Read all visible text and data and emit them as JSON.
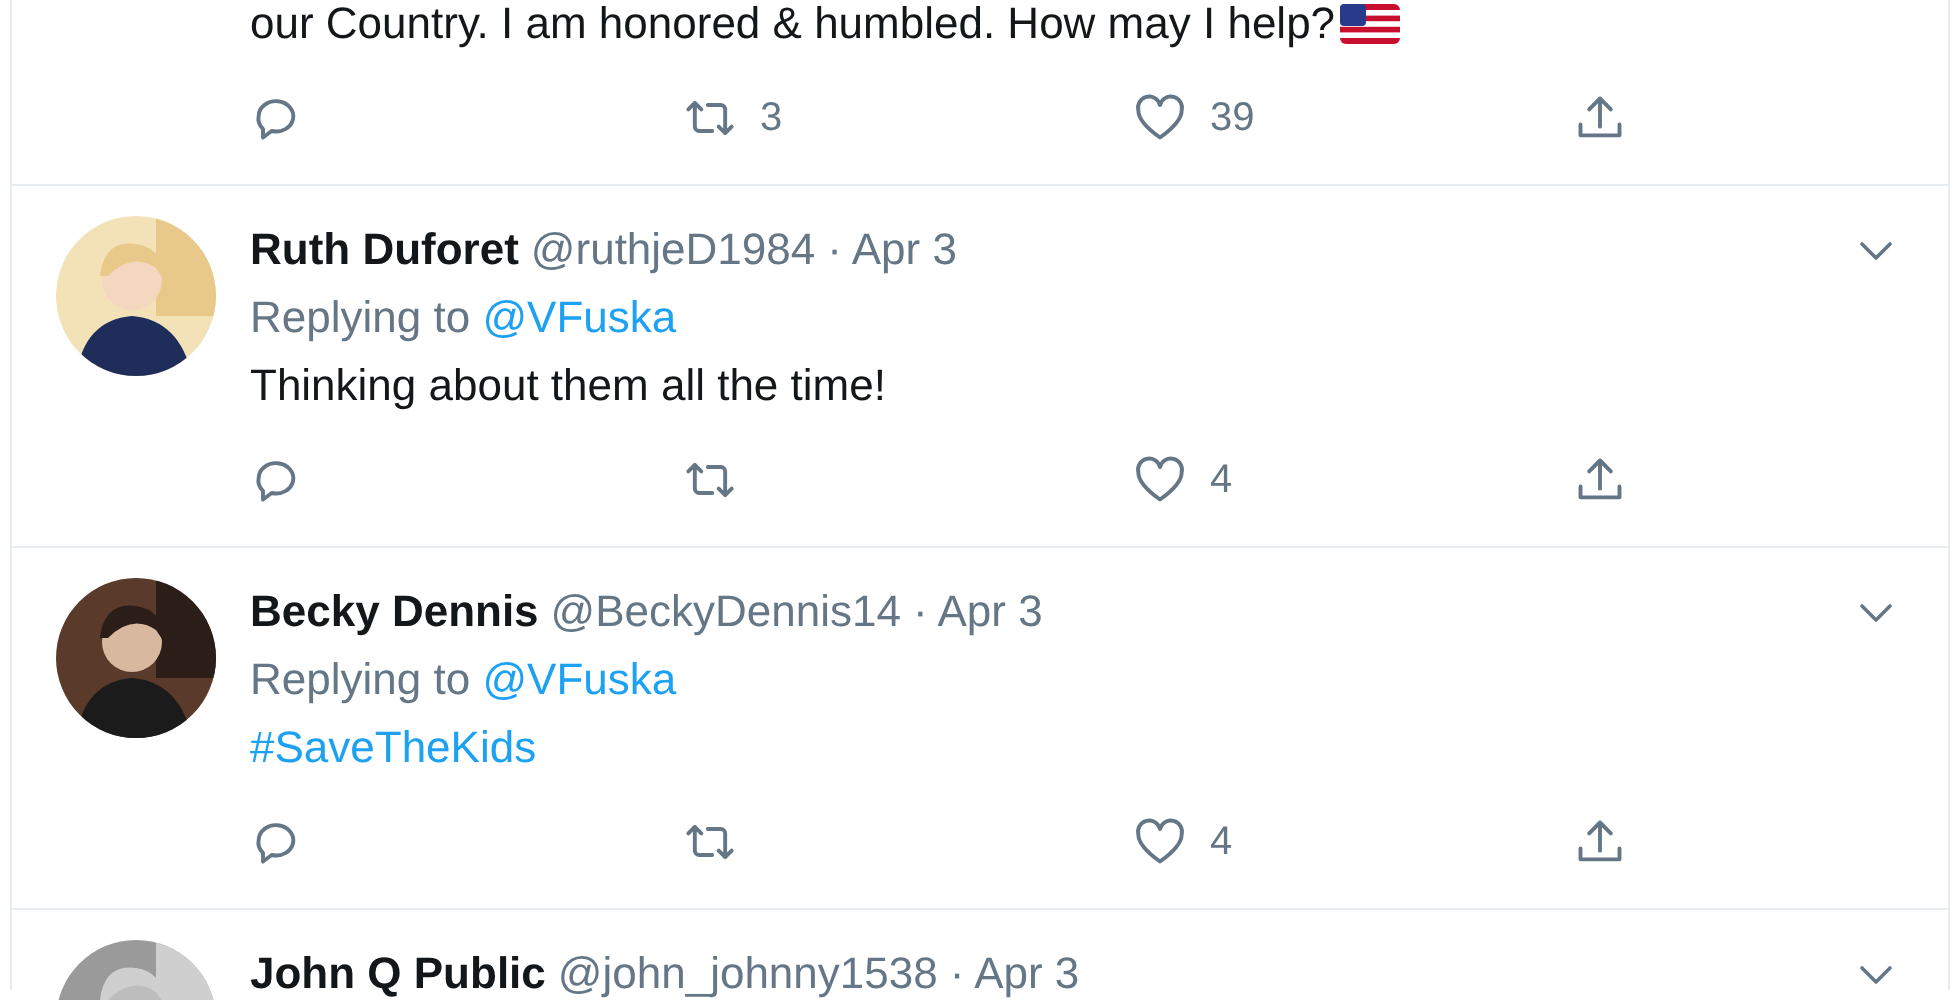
{
  "tweets": [
    {
      "kind": "partial",
      "body": {
        "kind": "text",
        "text": "our Country. I am honored & humbled. How may I help?"
      },
      "actions": {
        "retweets": "3",
        "likes": "39"
      }
    },
    {
      "kind": "reply",
      "name": "Ruth Duforet",
      "handle": "@ruthjeD1984",
      "date": "· Apr 3",
      "replying": "Replying to",
      "reply_to": "@VFuska",
      "body": {
        "kind": "text",
        "text": "Thinking about them all the time!"
      },
      "actions": {
        "likes": "4"
      }
    },
    {
      "kind": "reply",
      "name": "Becky Dennis",
      "handle": "@BeckyDennis14",
      "date": "· Apr 3",
      "replying": "Replying to",
      "reply_to": "@VFuska",
      "body": {
        "kind": "hashtag",
        "text": "#SaveTheKids"
      },
      "actions": {
        "likes": "4"
      }
    },
    {
      "kind": "header",
      "name": "John Q Public",
      "handle": "@john_johnny1538",
      "date": "· Apr 3"
    }
  ]
}
